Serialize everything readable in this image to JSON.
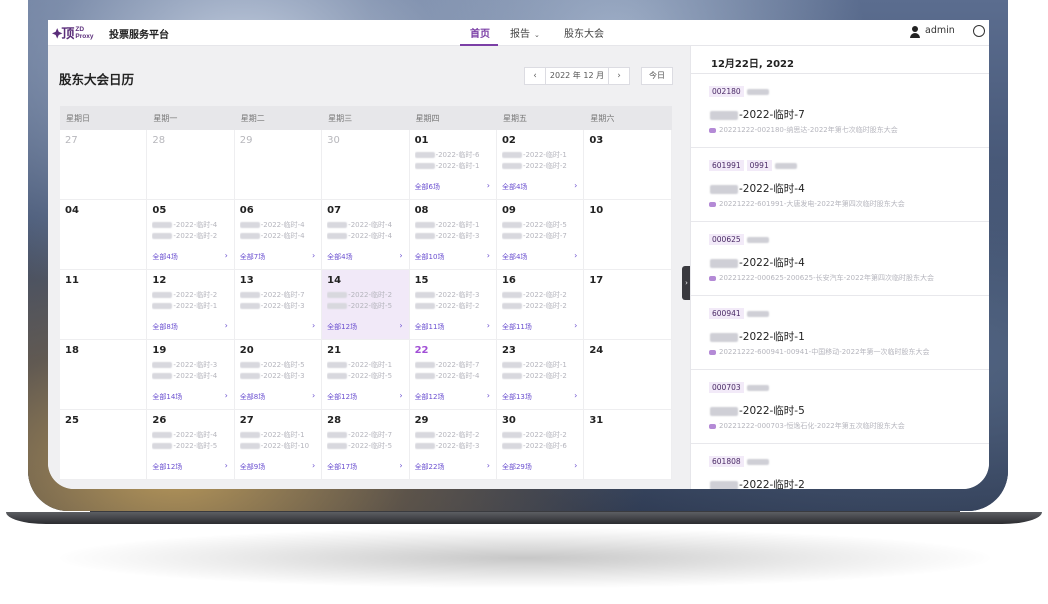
{
  "nav": {
    "logo_glyph": "🟆顶",
    "logo_line1": "ZD",
    "logo_line2": "Proxy",
    "platform_title": "投票服务平台",
    "tabs": [
      {
        "label": "首页",
        "active": true
      },
      {
        "label": "报告",
        "has_dropdown": true
      },
      {
        "label": "股东大会"
      }
    ],
    "user": "admin"
  },
  "calendar": {
    "title": "股东大会日历",
    "month_label": "2022 年 12 月",
    "prev": "‹",
    "next": "›",
    "today_button": "今日",
    "weekdays": [
      "星期日",
      "星期一",
      "星期二",
      "星期三",
      "星期四",
      "星期五",
      "星期六"
    ],
    "weeks": [
      [
        {
          "d": "27",
          "other": true
        },
        {
          "d": "28",
          "other": true
        },
        {
          "d": "29",
          "other": true
        },
        {
          "d": "30",
          "other": true
        },
        {
          "d": "01",
          "events": [
            "-2022-临时-6",
            "-2022-临时-1"
          ],
          "more": "全部6场"
        },
        {
          "d": "02",
          "events": [
            "-2022-临时-1",
            "-2022-临时-2"
          ],
          "more": "全部4场"
        },
        {
          "d": "03"
        }
      ],
      [
        {
          "d": "04"
        },
        {
          "d": "05",
          "events": [
            "-2022-临时-4",
            "-2022-临时-2"
          ],
          "more": "全部4场"
        },
        {
          "d": "06",
          "events": [
            "-2022-临时-4",
            "-2022-临时-4"
          ],
          "more": "全部7场"
        },
        {
          "d": "07",
          "events": [
            "-2022-临时-4",
            "-2022-临时-4"
          ],
          "more": "全部4场"
        },
        {
          "d": "08",
          "events": [
            "-2022-临时-1",
            "-2022-临时-3"
          ],
          "more": "全部10场"
        },
        {
          "d": "09",
          "events": [
            "-2022-临时-5",
            "-2022-临时-7"
          ],
          "more": "全部4场"
        },
        {
          "d": "10"
        }
      ],
      [
        {
          "d": "11"
        },
        {
          "d": "12",
          "events": [
            "-2022-临时-2",
            "-2022-临时-1"
          ],
          "more": "全部8场"
        },
        {
          "d": "13",
          "events": [
            "-2022-临时-7",
            "-2022-临时-3"
          ]
        },
        {
          "d": "14",
          "highlight": true,
          "events": [
            "-2022-临时-2",
            "-2022-临时-5"
          ],
          "more": "全部12场"
        },
        {
          "d": "15",
          "events": [
            "-2022-临时-3",
            "-2022-临时-2"
          ],
          "more": "全部11场"
        },
        {
          "d": "16",
          "events": [
            "-2022-临时-2",
            "-2022-临时-2"
          ],
          "more": "全部11场"
        },
        {
          "d": "17"
        }
      ],
      [
        {
          "d": "18"
        },
        {
          "d": "19",
          "events": [
            "-2022-临时-3",
            "-2022-临时-4"
          ],
          "more": "全部14场"
        },
        {
          "d": "20",
          "events": [
            "-2022-临时-5",
            "-2022-临时-3"
          ],
          "more": "全部8场"
        },
        {
          "d": "21",
          "events": [
            "-2022-临时-1",
            "-2022-临时-5"
          ],
          "more": "全部12场"
        },
        {
          "d": "22",
          "today": true,
          "events": [
            "-2022-临时-7",
            "-2022-临时-4"
          ],
          "more": "全部12场"
        },
        {
          "d": "23",
          "events": [
            "-2022-临时-1",
            "-2022-临时-2"
          ],
          "more": "全部13场"
        },
        {
          "d": "24"
        }
      ],
      [
        {
          "d": "25"
        },
        {
          "d": "26",
          "events": [
            "-2022-临时-4",
            "-2022-临时-5"
          ],
          "more": "全部12场"
        },
        {
          "d": "27",
          "events": [
            "-2022-临时-1",
            "-2022-临时-10"
          ],
          "more": "全部9场"
        },
        {
          "d": "28",
          "events": [
            "-2022-临时-7",
            "-2022-临时-5"
          ],
          "more": "全部17场"
        },
        {
          "d": "29",
          "events": [
            "-2022-临时-2",
            "-2022-临时-3"
          ],
          "more": "全部22场"
        },
        {
          "d": "30",
          "events": [
            "-2022-临时-2",
            "-2022-临时-6"
          ],
          "more": "全部29场"
        },
        {
          "d": "31"
        }
      ]
    ],
    "more_arrow": "›"
  },
  "list": {
    "date_heading": "12月22日, 2022",
    "collapse_glyph": "›",
    "items": [
      {
        "codes": [
          "002180"
        ],
        "title": "-2022-临时-7",
        "desc": "20221222-002180-纳思达-2022年第七次临时股东大会"
      },
      {
        "codes": [
          "601991",
          "0991"
        ],
        "title": "-2022-临时-4",
        "desc": "20221222-601991-大唐发电-2022年第四次临时股东大会"
      },
      {
        "codes": [
          "000625"
        ],
        "title": "-2022-临时-4",
        "desc": "20221222-000625-200625-长安汽车-2022年第四次临时股东大会"
      },
      {
        "codes": [
          "600941"
        ],
        "title": "-2022-临时-1",
        "desc": "20221222-600941-00941-中国移动-2022年第一次临时股东大会"
      },
      {
        "codes": [
          "000703"
        ],
        "title": "-2022-临时-5",
        "desc": "20221222-000703-恒逸石化-2022年第五次临时股东大会"
      },
      {
        "codes": [
          "601808"
        ],
        "title": "-2022-临时-2",
        "desc": ""
      }
    ]
  }
}
